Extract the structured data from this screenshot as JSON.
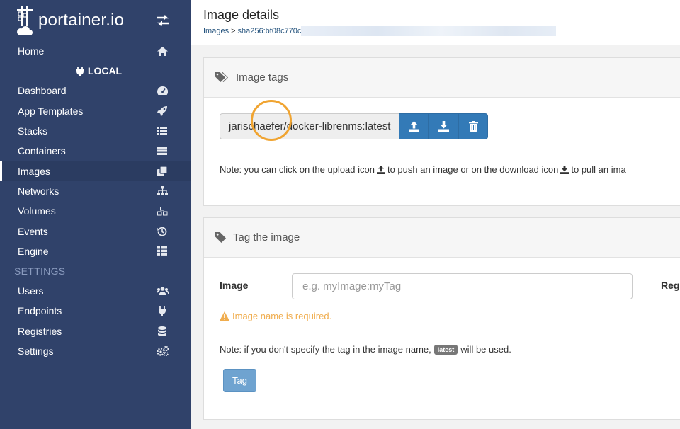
{
  "brand": {
    "name": "portainer.io"
  },
  "sidebar": {
    "home": "Home",
    "endpoint": "LOCAL",
    "items": [
      {
        "label": "Dashboard",
        "icon": "tachometer-icon"
      },
      {
        "label": "App Templates",
        "icon": "rocket-icon"
      },
      {
        "label": "Stacks",
        "icon": "list-icon"
      },
      {
        "label": "Containers",
        "icon": "server-icon"
      },
      {
        "label": "Images",
        "icon": "clone-icon",
        "active": true
      },
      {
        "label": "Networks",
        "icon": "sitemap-icon"
      },
      {
        "label": "Volumes",
        "icon": "cubes-icon"
      },
      {
        "label": "Events",
        "icon": "history-icon"
      },
      {
        "label": "Engine",
        "icon": "th-icon"
      }
    ],
    "settings_label": "SETTINGS",
    "settings_items": [
      {
        "label": "Users",
        "icon": "users-icon"
      },
      {
        "label": "Endpoints",
        "icon": "plug-icon"
      },
      {
        "label": "Registries",
        "icon": "database-icon"
      },
      {
        "label": "Settings",
        "icon": "cogs-icon"
      }
    ]
  },
  "header": {
    "title": "Image details",
    "breadcrumb_root": "Images",
    "breadcrumb_sep": ">",
    "breadcrumb_current": "sha256:bf08c770c"
  },
  "image_tags": {
    "title": "Image tags",
    "tag": "jarischaefer/docker-librenms:latest",
    "note_part1": "Note: you can click on the upload icon",
    "note_part2": "to push an image or on the download icon",
    "note_part3": "to pull an ima"
  },
  "tag_image": {
    "title": "Tag the image",
    "image_label": "Image",
    "image_placeholder": "e.g. myImage:myTag",
    "image_value": "",
    "registry_label": "Reg",
    "warning": "Image name is required.",
    "note_part1": "Note: if you don't specify the tag in the image name,",
    "note_badge": "latest",
    "note_part2": "will be used.",
    "submit_label": "Tag"
  },
  "colors": {
    "sidebar_bg": "#30426a",
    "primary": "#337ab7",
    "warning": "#f0ad4e",
    "highlight_ring": "#f0a431"
  }
}
